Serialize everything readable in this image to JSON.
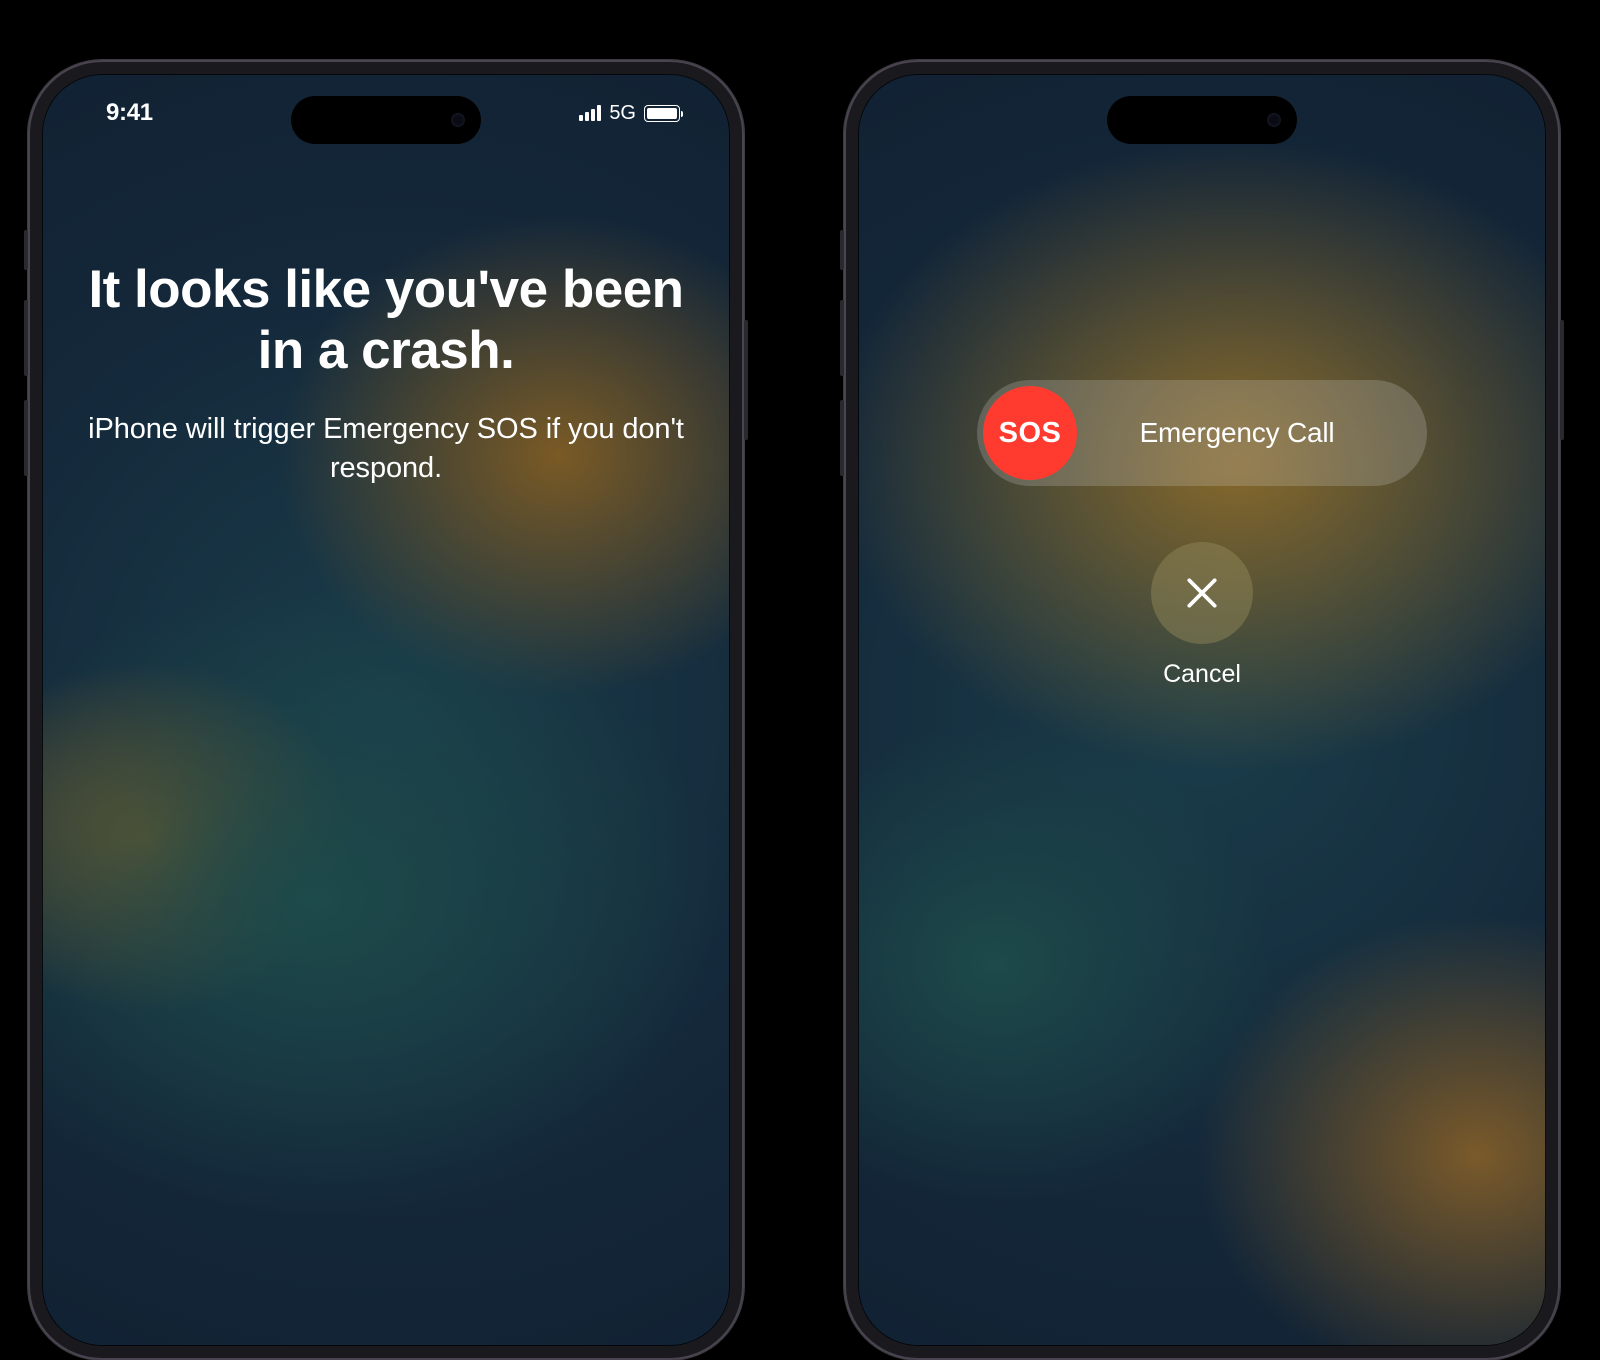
{
  "left_phone": {
    "status": {
      "time": "9:41",
      "network": "5G"
    },
    "heading": "It looks like you've been in a crash.",
    "subheading": "iPhone will trigger Emergency SOS if you don't respond."
  },
  "right_phone": {
    "slider": {
      "knob_label": "SOS",
      "track_label": "Emergency Call"
    },
    "cancel_label": "Cancel"
  },
  "colors": {
    "sos_red": "#ff3b30",
    "background": "#000000"
  }
}
